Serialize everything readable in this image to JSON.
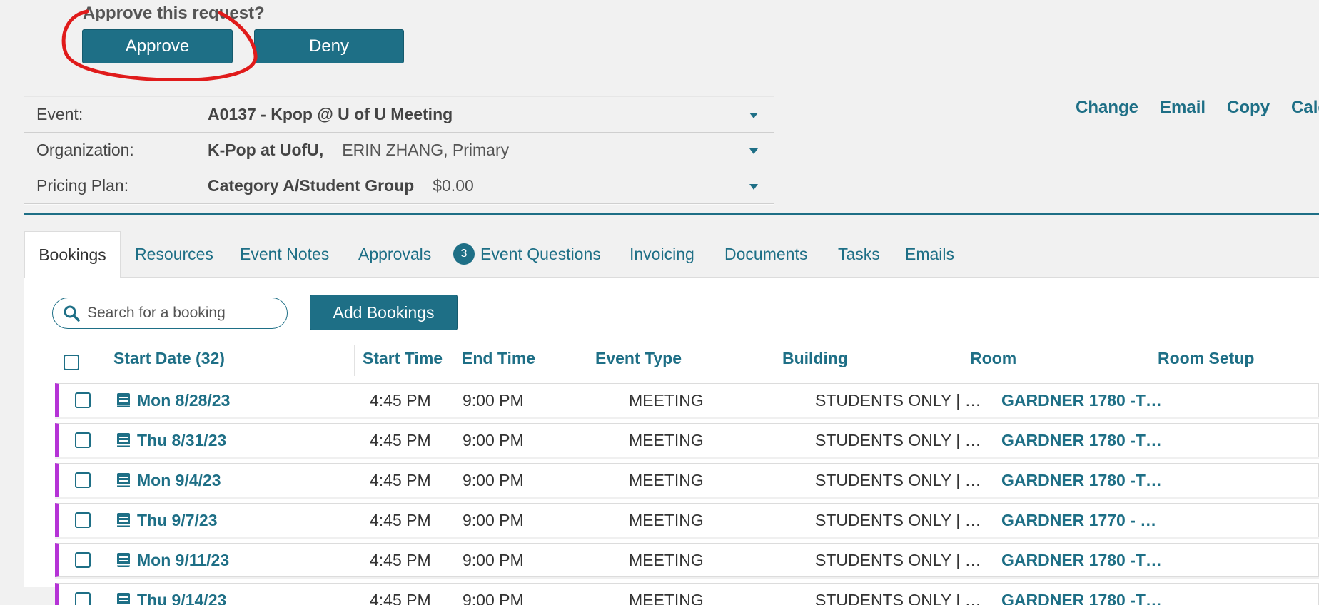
{
  "approval": {
    "prompt": "Approve this request?",
    "approve_label": "Approve",
    "deny_label": "Deny"
  },
  "info": [
    {
      "label": "Event:",
      "value": "A0137 - Kpop @ U of U Meeting",
      "sub": ""
    },
    {
      "label": "Organization:",
      "value": "K-Pop at UofU,",
      "sub": "ERIN ZHANG,  Primary"
    },
    {
      "label": "Pricing Plan:",
      "value": "Category A/Student Group",
      "sub": "$0.00"
    }
  ],
  "actions": [
    "Change",
    "Email",
    "Copy",
    "Calen"
  ],
  "tabs": {
    "bookings": "Bookings",
    "resources": "Resources",
    "event_notes": "Event Notes",
    "approvals": "Approvals",
    "event_questions_count": "3",
    "event_questions": "Event Questions",
    "invoicing": "Invoicing",
    "documents": "Documents",
    "tasks": "Tasks",
    "emails": "Emails"
  },
  "search": {
    "placeholder": "Search for a booking"
  },
  "add_bookings_label": "Add Bookings",
  "columns": {
    "start_date": "Start Date (32)",
    "start_time": "Start Time",
    "end_time": "End Time",
    "event_type": "Event Type",
    "building": "Building",
    "room": "Room",
    "room_setup": "Room Setup"
  },
  "rows": [
    {
      "date": "Mon 8/28/23",
      "start": "4:45 PM",
      "end": "9:00 PM",
      "type": "MEETING",
      "building": "STUDENTS ONLY | …",
      "room": "GARDNER 1780 -T…"
    },
    {
      "date": "Thu 8/31/23",
      "start": "4:45 PM",
      "end": "9:00 PM",
      "type": "MEETING",
      "building": "STUDENTS ONLY | …",
      "room": "GARDNER 1780 -T…"
    },
    {
      "date": "Mon 9/4/23",
      "start": "4:45 PM",
      "end": "9:00 PM",
      "type": "MEETING",
      "building": "STUDENTS ONLY | …",
      "room": "GARDNER 1780 -T…"
    },
    {
      "date": "Thu 9/7/23",
      "start": "4:45 PM",
      "end": "9:00 PM",
      "type": "MEETING",
      "building": "STUDENTS ONLY | …",
      "room": "GARDNER 1770 - …"
    },
    {
      "date": "Mon 9/11/23",
      "start": "4:45 PM",
      "end": "9:00 PM",
      "type": "MEETING",
      "building": "STUDENTS ONLY | …",
      "room": "GARDNER 1780 -T…"
    },
    {
      "date": "Thu 9/14/23",
      "start": "4:45 PM",
      "end": "9:00 PM",
      "type": "MEETING",
      "building": "STUDENTS ONLY | …",
      "room": "GARDNER 1780 -T…"
    }
  ],
  "colors": {
    "accent": "#1e6f86",
    "row_marker": "#b533d6",
    "annotation": "#e01b1b"
  }
}
